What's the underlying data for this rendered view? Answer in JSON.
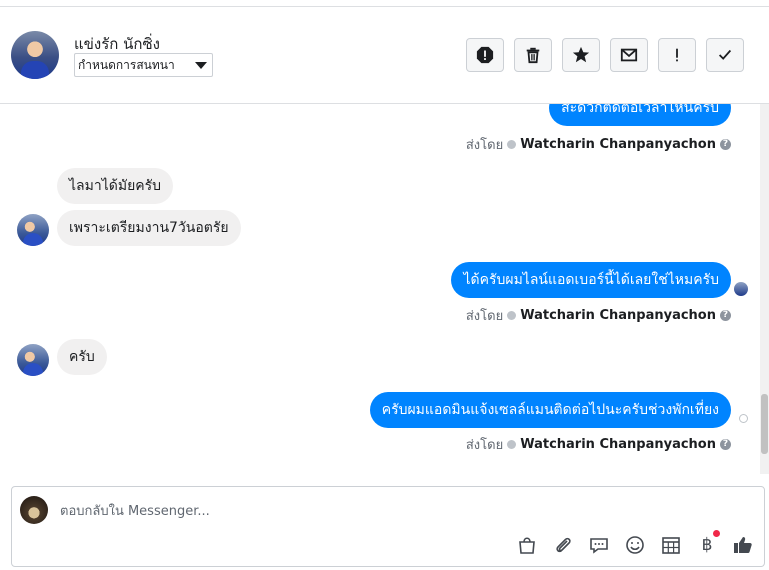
{
  "header": {
    "contact_name": "แข่งรัก นักซิ่ง",
    "conversation_select": "กำหนดการสนทนา"
  },
  "toolbar": {
    "icons": [
      "spam-alert-icon",
      "trash-icon",
      "star-icon",
      "envelope-icon",
      "exclamation-icon",
      "checkmark-icon"
    ]
  },
  "thread": {
    "messages": [
      {
        "direction": "out",
        "text": "สะดวกติดต่อเวลาไหนครับ"
      },
      {
        "direction": "in",
        "text": "ไลมาได้มัยครับ"
      },
      {
        "direction": "in",
        "text": "เพราะเตรียมงาน7วันอตรัย"
      },
      {
        "direction": "out",
        "text": "ได้ครับผมไลน์แอดเบอร์นี้ได้เลยใช่ไหมครับ"
      },
      {
        "direction": "in",
        "text": "ครับ"
      },
      {
        "direction": "out",
        "text": "ครับผมแอดมินแจ้งเซลล์แมนติดต่อไปนะครับช่วงพักเที่ยง"
      }
    ],
    "sent_by_label": "ส่งโดย",
    "sender_name": "Watcharin Chanpanyachon",
    "help_glyph": "?"
  },
  "composer": {
    "placeholder": "ตอบกลับใน Messenger...",
    "currency_glyph": "฿"
  },
  "colors": {
    "outgoing_bubble": "#0084ff",
    "incoming_bubble": "#f1f0f0",
    "notification_dot": "#f02849"
  }
}
